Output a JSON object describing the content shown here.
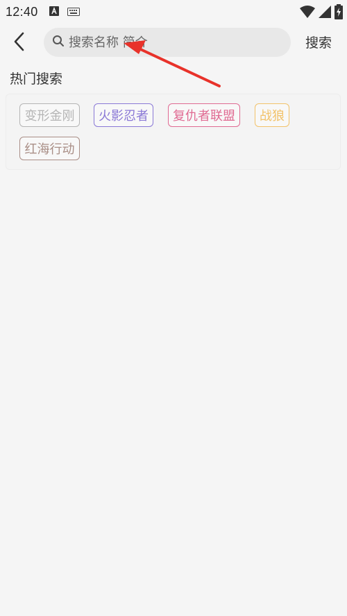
{
  "status_bar": {
    "time": "12:40",
    "icons": [
      "a-notification-icon",
      "keyboard-icon",
      "wifi-icon",
      "signal-icon",
      "battery-icon"
    ]
  },
  "header": {
    "back_icon": "chevron-left-icon",
    "search": {
      "placeholder": "搜索名称 简介",
      "value": "",
      "icon": "search-icon"
    },
    "submit_label": "搜索"
  },
  "hot_search": {
    "title": "热门搜索",
    "tags": [
      {
        "label": "变形金刚",
        "color": "#b5b5b5"
      },
      {
        "label": "火影忍者",
        "color": "#8a78d6"
      },
      {
        "label": "复仇者联盟",
        "color": "#e06a92"
      },
      {
        "label": "战狼",
        "color": "#f2c26a"
      },
      {
        "label": "红海行动",
        "color": "#a98e86"
      }
    ]
  },
  "colors": {
    "background": "#f5f5f5",
    "search_box": "#e8e8e8",
    "annotation_arrow": "#e8322a"
  }
}
